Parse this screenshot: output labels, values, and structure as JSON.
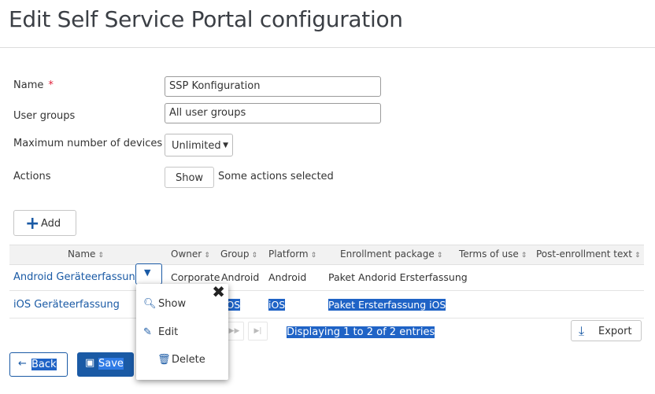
{
  "page": {
    "title": "Edit Self Service Portal configuration"
  },
  "form": {
    "name_label": "Name",
    "required_mark": "*",
    "name_value": "SSP Konfiguration",
    "user_groups_label": "User groups",
    "user_groups_value": "All user groups",
    "max_devices_label": "Maximum number of devices",
    "max_devices_value": "Unlimited",
    "actions_label": "Actions",
    "actions_show_label": "Show",
    "actions_status": "Some actions selected"
  },
  "toolbar": {
    "add_label": "Add"
  },
  "table": {
    "columns": [
      "Name",
      "Owner",
      "Group",
      "Platform",
      "Enrollment package",
      "Terms of use",
      "Post-enrollment text"
    ],
    "rows": [
      {
        "name": "Android Geräteerfassung",
        "owner": "Corporate",
        "group": "Android",
        "platform": "Android",
        "package": "Paket Andorid Ersterfassung"
      },
      {
        "name": "iOS Geräteerfassung",
        "group": "iOS",
        "platform": "iOS",
        "package": "Paket Ersterfassung iOS"
      }
    ],
    "pagination_text": "Displaying 1 to 2 of 2 entries",
    "export_label": "Export"
  },
  "context_menu": {
    "items": [
      {
        "label": "Show",
        "icon": "search-icon"
      },
      {
        "label": "Edit",
        "icon": "edit-icon"
      },
      {
        "label": "Delete",
        "icon": "trash-icon"
      }
    ]
  },
  "footer": {
    "back_label": "Back",
    "save_label": "Save"
  }
}
